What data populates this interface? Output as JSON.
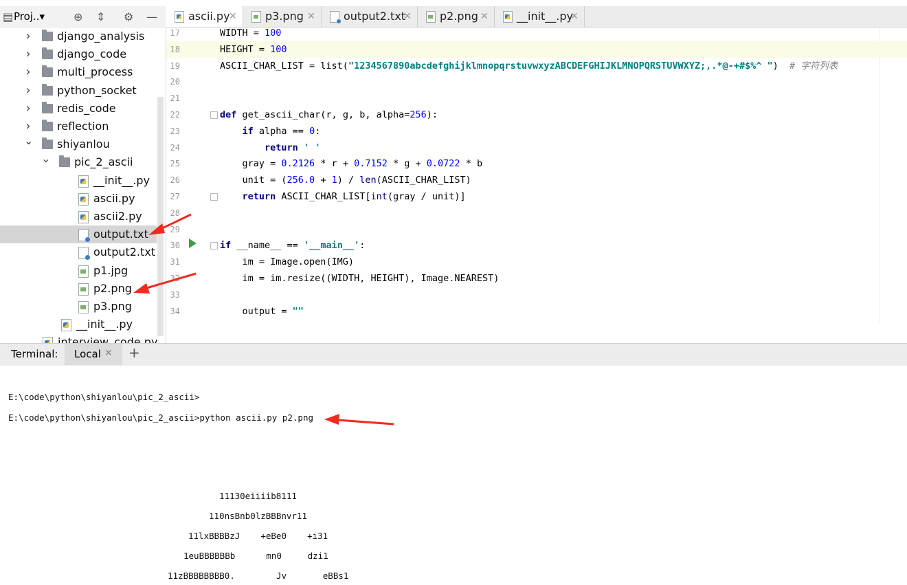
{
  "project_panel": {
    "title": "Proj..▾",
    "tree": [
      {
        "label": "django_analysis",
        "type": "folder",
        "expanded": false
      },
      {
        "label": "django_code",
        "type": "folder",
        "expanded": false
      },
      {
        "label": "multi_process",
        "type": "folder",
        "expanded": false
      },
      {
        "label": "python_socket",
        "type": "folder",
        "expanded": false
      },
      {
        "label": "redis_code",
        "type": "folder",
        "expanded": false
      },
      {
        "label": "reflection",
        "type": "folder",
        "expanded": false
      },
      {
        "label": "shiyanlou",
        "type": "folder",
        "expanded": true
      },
      {
        "label": "pic_2_ascii",
        "type": "folder",
        "expanded": true
      },
      {
        "label": "__init__.py",
        "type": "py"
      },
      {
        "label": "ascii.py",
        "type": "py"
      },
      {
        "label": "ascii2.py",
        "type": "py"
      },
      {
        "label": "output.txt",
        "type": "txt",
        "selected": true
      },
      {
        "label": "output2.txt",
        "type": "txt"
      },
      {
        "label": "p1.jpg",
        "type": "img"
      },
      {
        "label": "p2.png",
        "type": "img"
      },
      {
        "label": "p3.png",
        "type": "img"
      },
      {
        "label": "__init__.py",
        "type": "py"
      },
      {
        "label": "interview_code.py",
        "type": "py"
      }
    ]
  },
  "editor_tabs": [
    {
      "label": "ascii.py",
      "icon": "python-file-icon",
      "active": true
    },
    {
      "label": "p3.png",
      "icon": "image-file-icon",
      "active": false
    },
    {
      "label": "output2.txt",
      "icon": "text-file-icon",
      "active": false
    },
    {
      "label": "p2.png",
      "icon": "image-file-icon",
      "active": false
    },
    {
      "label": "__init__.py",
      "icon": "python-file-icon",
      "active": false
    }
  ],
  "code_lines": [
    {
      "n": "17",
      "html": "WIDTH = <span class='num'>100</span>"
    },
    {
      "n": "18",
      "html": "HEIGHT = <span class='num'>100</span>"
    },
    {
      "n": "19",
      "html": "ASCII_CHAR_LIST = list(<span class='str'>\"1234567890abcdefghijklmnopqrstuvwxyzABCDEFGHIJKLMNOPQRSTUVWXYZ;,.*@-+#$%^ \"</span>)  <span class='cmt'># 字符列表</span>"
    },
    {
      "n": "20",
      "html": ""
    },
    {
      "n": "21",
      "html": ""
    },
    {
      "n": "22",
      "html": "<span class='kw'>def</span> get_ascii_char(r, g, b, alpha=<span class='num'>256</span>):"
    },
    {
      "n": "23",
      "html": "    <span class='kw'>if</span> alpha == <span class='num'>0</span>:"
    },
    {
      "n": "24",
      "html": "        <span class='kw'>return</span> <span class='str'>' '</span>"
    },
    {
      "n": "25",
      "html": "    gray = <span class='num'>0.2126</span> * r + <span class='num'>0.7152</span> * g + <span class='num'>0.0722</span> * b"
    },
    {
      "n": "26",
      "html": "    unit = (<span class='num'>256.0</span> + <span class='num'>1</span>) / <span class='bi'>len</span>(ASCII_CHAR_LIST)"
    },
    {
      "n": "27",
      "html": "    <span class='kw'>return</span> ASCII_CHAR_LIST[<span class='bi'>int</span>(gray / unit)]"
    },
    {
      "n": "28",
      "html": ""
    },
    {
      "n": "29",
      "html": ""
    },
    {
      "n": "30",
      "html": "<span class='kw'>if</span> __name__ == <span class='str'>'__main__'</span>:"
    },
    {
      "n": "31",
      "html": "    im = Image.open(IMG)"
    },
    {
      "n": "32",
      "html": "    im = im.resize((WIDTH, HEIGHT), Image.NEAREST)"
    },
    {
      "n": "33",
      "html": ""
    },
    {
      "n": "34",
      "html": "    output = <span class='str'>\"\"</span>"
    }
  ],
  "terminal": {
    "title": "Terminal:",
    "tab_label": "Local",
    "lines": [
      "E:\\code\\python\\shiyanlou\\pic_2_ascii>",
      "E:\\code\\python\\shiyanlou\\pic_2_ascii>python ascii.py p2.png"
    ],
    "ascii_art": [
      "11130eiiiib8111",
      "110nsBnb0lzBBBnvr11",
      "11lxBBBBzJ    +eBe0    +i31",
      "1euBBBBBBb      mn0     dzi1",
      "11zBBBBBBBB0.        Jv       eBBs1"
    ]
  }
}
